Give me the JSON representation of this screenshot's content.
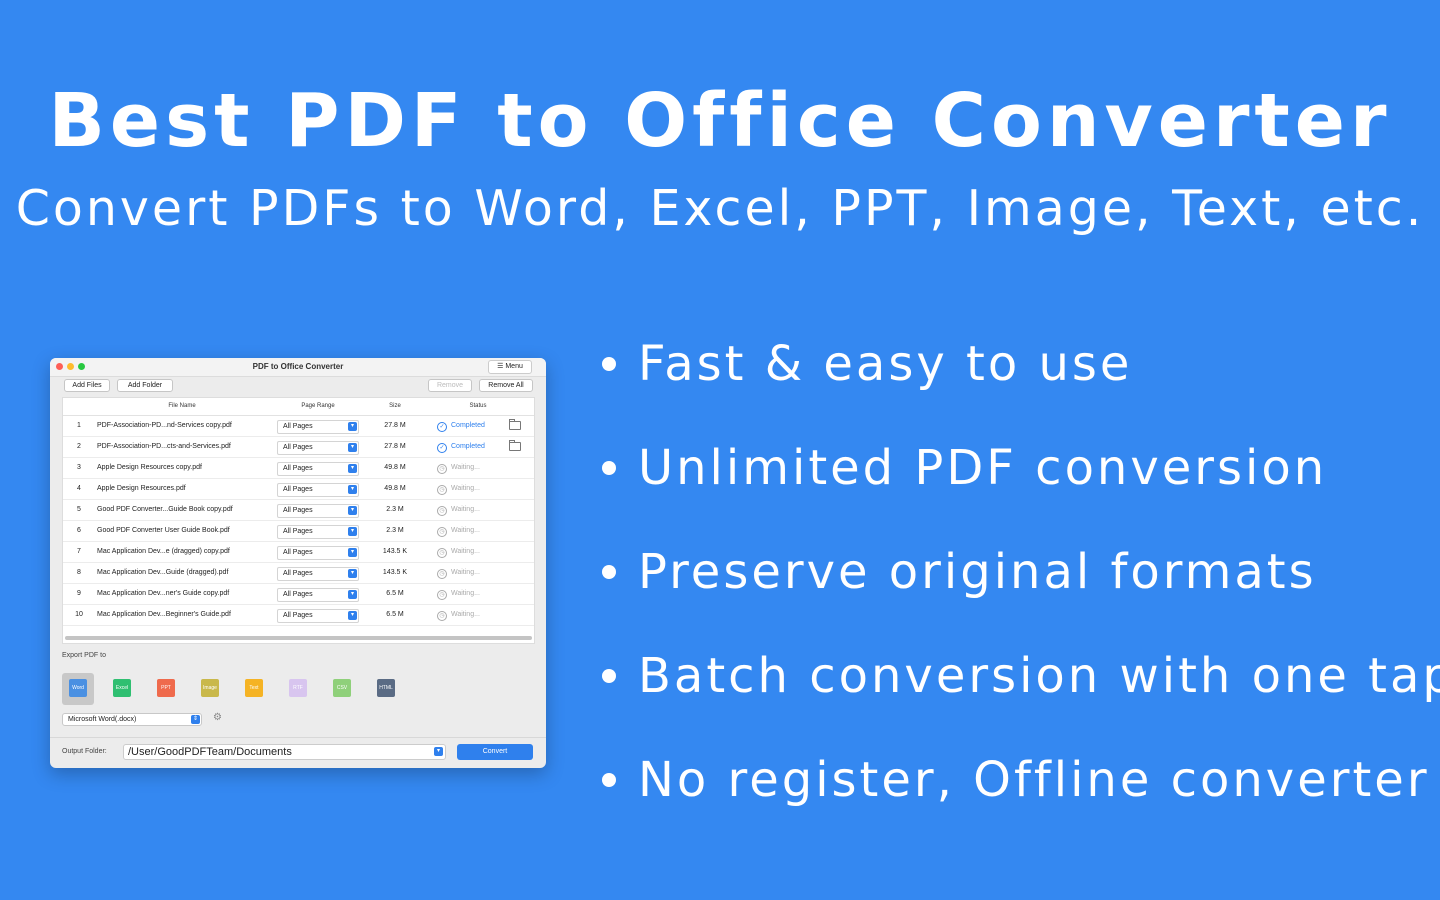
{
  "hero": {
    "title": "Best PDF to Office Converter",
    "subtitle": "Convert PDFs to Word, Excel, PPT, Image, Text, etc."
  },
  "features": [
    "Fast & easy to use",
    "Unlimited PDF conversion",
    "Preserve original formats",
    "Batch conversion with one tap",
    "No register, Offline converter"
  ],
  "app": {
    "title": "PDF to Office Converter",
    "menu_label": "☰ Menu",
    "toolbar": {
      "add_files": "Add Files",
      "add_folder": "Add Folder",
      "remove": "Remove",
      "remove_all": "Remove All"
    },
    "columns": [
      "File Name",
      "Page Range",
      "Size",
      "Status"
    ],
    "rows": [
      {
        "n": "1",
        "name": "PDF-Association-PD...nd-Services copy.pdf",
        "range": "All Pages",
        "size": "27.8 M",
        "status": "Completed",
        "done": true
      },
      {
        "n": "2",
        "name": "PDF-Association-PD...cts-and-Services.pdf",
        "range": "All Pages",
        "size": "27.8 M",
        "status": "Completed",
        "done": true
      },
      {
        "n": "3",
        "name": "Apple Design Resources copy.pdf",
        "range": "All Pages",
        "size": "49.8 M",
        "status": "Waiting...",
        "done": false
      },
      {
        "n": "4",
        "name": "Apple Design Resources.pdf",
        "range": "All Pages",
        "size": "49.8 M",
        "status": "Waiting...",
        "done": false
      },
      {
        "n": "5",
        "name": "Good PDF Converter...Guide Book copy.pdf",
        "range": "All Pages",
        "size": "2.3 M",
        "status": "Waiting...",
        "done": false
      },
      {
        "n": "6",
        "name": "Good PDF Converter User Guide Book.pdf",
        "range": "All Pages",
        "size": "2.3 M",
        "status": "Waiting...",
        "done": false
      },
      {
        "n": "7",
        "name": "Mac Application Dev...e (dragged) copy.pdf",
        "range": "All Pages",
        "size": "143.5 K",
        "status": "Waiting...",
        "done": false
      },
      {
        "n": "8",
        "name": "Mac Application Dev...Guide (dragged).pdf",
        "range": "All Pages",
        "size": "143.5 K",
        "status": "Waiting...",
        "done": false
      },
      {
        "n": "9",
        "name": "Mac Application Dev...ner's Guide copy.pdf",
        "range": "All Pages",
        "size": "6.5 M",
        "status": "Waiting...",
        "done": false
      },
      {
        "n": "10",
        "name": "Mac Application Dev...Beginner's Guide.pdf",
        "range": "All Pages",
        "size": "6.5 M",
        "status": "Waiting...",
        "done": false
      }
    ],
    "export_label": "Export PDF to",
    "formats": [
      {
        "label": "Word",
        "color": "#4a90e2",
        "selected": true
      },
      {
        "label": "Excel",
        "color": "#2fbf71",
        "selected": false
      },
      {
        "label": "PPT",
        "color": "#ef6a4c",
        "selected": false
      },
      {
        "label": "Image",
        "color": "#c9b84a",
        "selected": false
      },
      {
        "label": "Text",
        "color": "#f5b324",
        "selected": false
      },
      {
        "label": "RTF",
        "color": "#d8c5ef",
        "selected": false
      },
      {
        "label": "CSV",
        "color": "#8fd07a",
        "selected": false
      },
      {
        "label": "HTML",
        "color": "#5a6b84",
        "selected": false
      }
    ],
    "format_select": "Microsoft Word(.docx)",
    "output_label": "Output Folder:",
    "output_path": "/User/GoodPDFTeam/Documents",
    "convert_label": "Convert"
  },
  "colors": {
    "background": "#3488f1",
    "accent": "#2f80ed",
    "completed": "#2f80ed",
    "waiting": "#aaaaaa"
  }
}
